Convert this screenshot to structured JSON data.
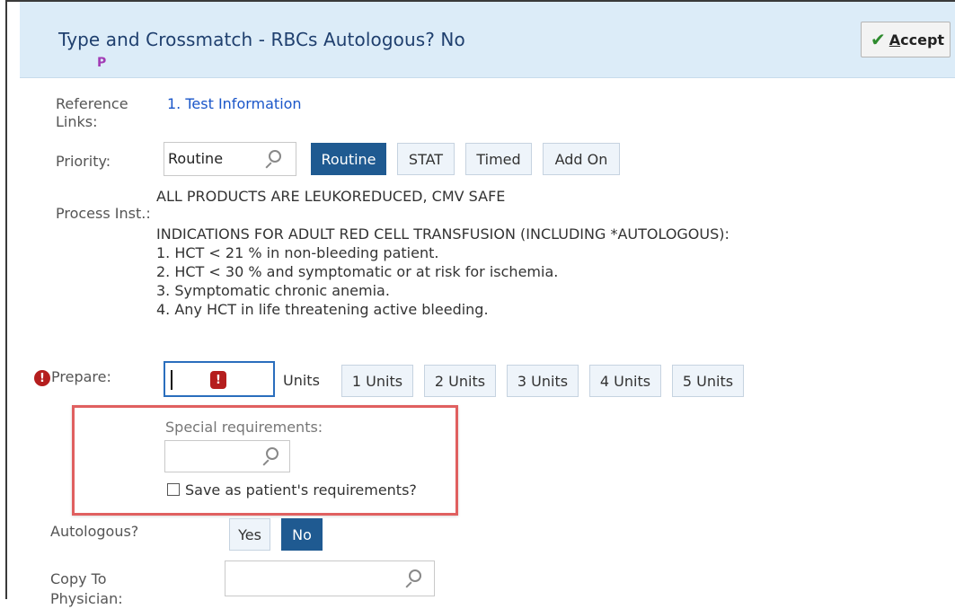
{
  "header": {
    "title": "Type and Crossmatch - RBCs Autologous? No",
    "badge": "P",
    "accept_prefix": "",
    "accept_underlined": "A",
    "accept_rest": "ccept"
  },
  "reference": {
    "label_line1": "Reference",
    "label_line2": "Links:",
    "link_text": "1. Test Information"
  },
  "priority": {
    "label": "Priority:",
    "value": "Routine",
    "options": [
      "Routine",
      "STAT",
      "Timed",
      "Add On"
    ],
    "selected": "Routine"
  },
  "process": {
    "label": "Process Inst.:",
    "lines": [
      "ALL PRODUCTS ARE LEUKOREDUCED, CMV SAFE",
      "",
      "INDICATIONS FOR ADULT RED CELL TRANSFUSION (INCLUDING *AUTOLOGOUS):",
      "1. HCT < 21 % in non-bleeding patient.",
      "2. HCT < 30 % and symptomatic or at risk for ischemia.",
      "3. Symptomatic chronic anemia.",
      "4. Any HCT in life threatening active bleeding."
    ]
  },
  "prepare": {
    "label": "Prepare:",
    "value": "",
    "units_label": "Units",
    "options": [
      "1 Units",
      "2 Units",
      "3 Units",
      "4 Units",
      "5 Units"
    ],
    "error_glyph": "!"
  },
  "special": {
    "label": "Special requirements:",
    "value": "",
    "checkbox_label": "Save as patient's requirements?",
    "checked": false
  },
  "autologous": {
    "label": "Autologous?",
    "options": [
      "Yes",
      "No"
    ],
    "selected": "No"
  },
  "copy_to": {
    "label_line1": "Copy To",
    "label_line2": "Physician:",
    "value": ""
  },
  "colors": {
    "header_bg": "#dcecf8",
    "selected_button": "#1f5a91",
    "link": "#1a56c9",
    "error": "#b51e1e",
    "highlight_box": "#e06060"
  }
}
